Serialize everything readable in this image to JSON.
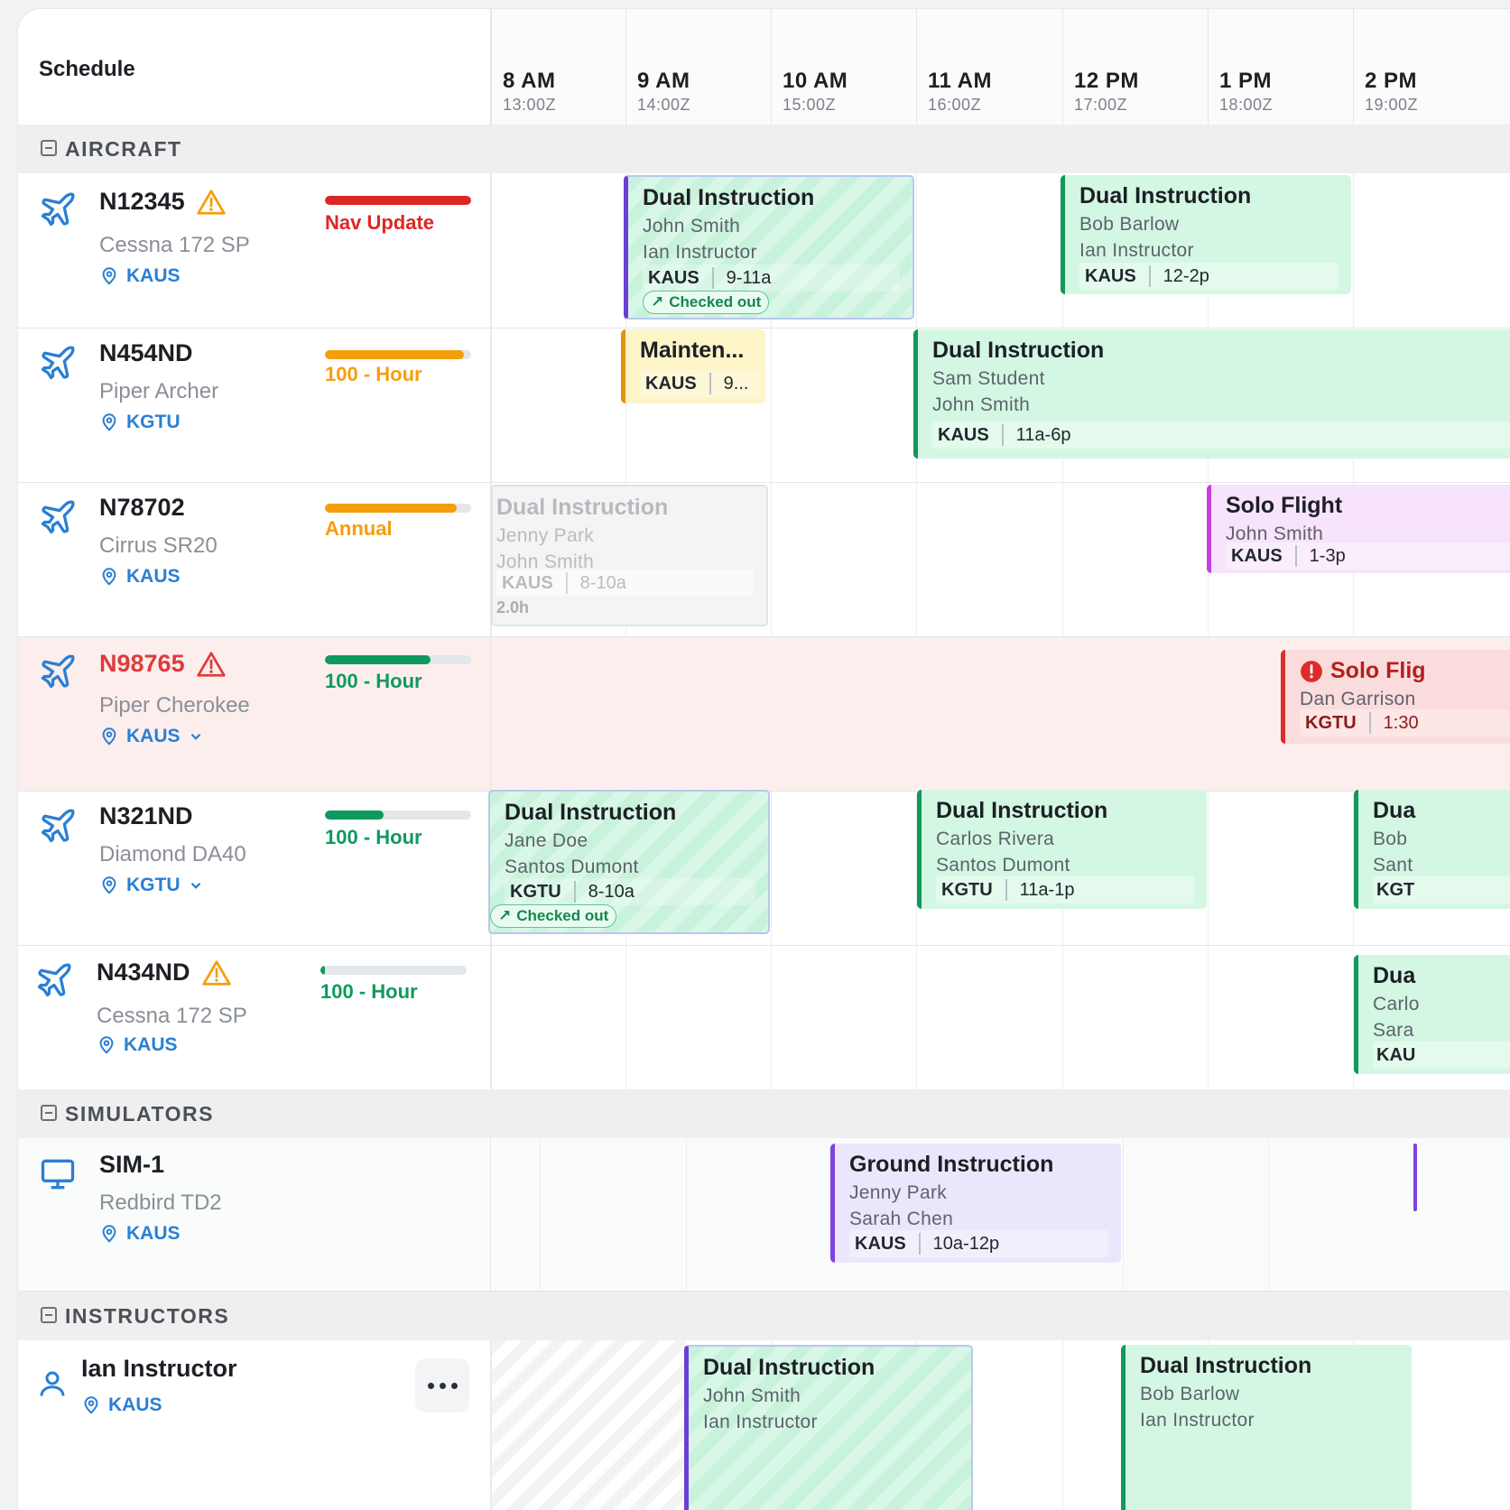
{
  "header": {
    "title": "Schedule"
  },
  "hours": [
    {
      "label": "8 AM",
      "zulu": "13:00Z"
    },
    {
      "label": "9 AM",
      "zulu": "14:00Z"
    },
    {
      "label": "10 AM",
      "zulu": "15:00Z"
    },
    {
      "label": "11 AM",
      "zulu": "16:00Z"
    },
    {
      "label": "12 PM",
      "zulu": "17:00Z"
    },
    {
      "label": "1 PM",
      "zulu": "18:00Z"
    },
    {
      "label": "2 PM",
      "zulu": "19:00Z"
    }
  ],
  "sections": {
    "aircraft": "AIRCRAFT",
    "simulators": "SIMULATORS",
    "instructors": "INSTRUCTORS"
  },
  "aircraft": [
    {
      "tail": "N12345",
      "model": "Cessna 172 SP",
      "location": "KAUS",
      "status": "Nav Update",
      "status_color": "#dc2626",
      "status_fill": 1.0,
      "warning": "orange"
    },
    {
      "tail": "N454ND",
      "model": "Piper Archer",
      "location": "KGTU",
      "status": "100 - Hour",
      "status_color": "#f59e0b",
      "status_fill": 0.95
    },
    {
      "tail": "N78702",
      "model": "Cirrus SR20",
      "location": "KAUS",
      "status": "Annual",
      "status_color": "#f59e0b",
      "status_fill": 0.9
    },
    {
      "tail": "N98765",
      "model": "Piper Cherokee",
      "location": "KAUS",
      "status": "100 - Hour",
      "status_color": "#0e9a5e",
      "status_fill": 0.72,
      "warning": "red",
      "alert": true
    },
    {
      "tail": "N321ND",
      "model": "Diamond DA40",
      "location": "KGTU",
      "status": "100 - Hour",
      "status_color": "#0e9a5e",
      "status_fill": 0.4
    },
    {
      "tail": "N434ND",
      "model": "Cessna 172 SP",
      "location": "KAUS",
      "status": "100 - Hour",
      "status_color": "#0e9a5e",
      "status_fill": 0.03,
      "warning": "orange"
    }
  ],
  "simulators": [
    {
      "name": "SIM-1",
      "model": "Redbird TD2",
      "location": "KAUS"
    }
  ],
  "instructors": [
    {
      "name": "Ian Instructor",
      "location": "KAUS"
    }
  ],
  "events": {
    "e1": {
      "title": "Dual Instruction",
      "line1": "John Smith",
      "line2": "Ian Instructor",
      "airport": "KAUS",
      "time": "9-11a",
      "badge": "Checked out"
    },
    "e2": {
      "title": "Dual Instruction",
      "line1": "Bob Barlow",
      "line2": "Ian Instructor",
      "airport": "KAUS",
      "time": "12-2p"
    },
    "e3": {
      "title": "Mainten...",
      "airport": "KAUS",
      "time": "9..."
    },
    "e4": {
      "title": "Dual Instruction",
      "line1": "Sam Student",
      "line2": "John Smith",
      "airport": "KAUS",
      "time": "11a-6p"
    },
    "e5": {
      "title": "Dual Instruction",
      "line1": "Jenny Park",
      "line2": "John Smith",
      "airport": "KAUS",
      "time": "8-10a",
      "duration": "2.0h"
    },
    "e6": {
      "title": "Solo Flight",
      "line1": "John Smith",
      "airport": "KAUS",
      "time": "1-3p"
    },
    "e7": {
      "title": "Solo Flig",
      "line1": "Dan Garrison",
      "airport": "KGTU",
      "time": "1:30"
    },
    "e8": {
      "title": "Dual Instruction",
      "line1": "Jane Doe",
      "line2": "Santos Dumont",
      "airport": "KGTU",
      "time": "8-10a",
      "badge": "Checked out"
    },
    "e9": {
      "title": "Dual Instruction",
      "line1": "Carlos Rivera",
      "line2": "Santos Dumont",
      "airport": "KGTU",
      "time": "11a-1p"
    },
    "e10": {
      "title": "Dua",
      "line1": "Bob",
      "line2": "Sant",
      "airport": "KGT"
    },
    "e11": {
      "title": "Dua",
      "line1": "Carlo",
      "line2": "Sara",
      "airport": "KAU"
    },
    "e12": {
      "title": "Ground Instruction",
      "line1": "Jenny Park",
      "line2": "Sarah Chen",
      "airport": "KAUS",
      "time": "10a-12p"
    },
    "e13": {
      "title": "Dual Instruction",
      "line1": "John Smith",
      "line2": "Ian Instructor"
    },
    "e14": {
      "title": "Dual Instruction",
      "line1": "Bob Barlow",
      "line2": "Ian Instructor"
    }
  }
}
